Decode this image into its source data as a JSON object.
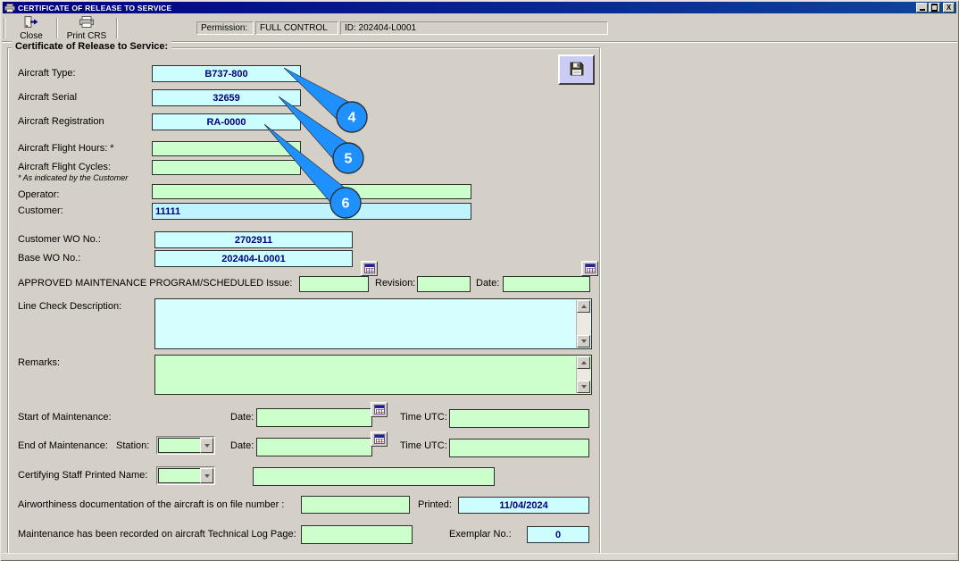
{
  "window": {
    "title": "CERTIFICATE OF RELEASE TO SERVICE",
    "close_glyph": "X"
  },
  "toolbar": {
    "close_label": "Close",
    "print_label": "Print CRS",
    "permission_label": "Permission:",
    "permission_value": "FULL CONTROL",
    "id_value": "ID: 202404-L0001"
  },
  "form": {
    "legend": "Certificate of Release to Service:",
    "aircraft_type": {
      "label": "Aircraft Type:",
      "value": "B737-800"
    },
    "aircraft_serial": {
      "label": "Aircraft Serial",
      "value": "32659"
    },
    "aircraft_registration": {
      "label": "Aircraft Registration",
      "value": "RA-0000"
    },
    "flight_hours": {
      "label": "Aircraft Flight Hours: *",
      "value": ""
    },
    "flight_cycles": {
      "label": "Aircraft Flight Cycles:",
      "value": ""
    },
    "footnote": "* As indicated by the Customer",
    "operator": {
      "label": "Operator:",
      "value": ""
    },
    "customer": {
      "label": "Customer:",
      "value": "11111"
    },
    "customer_wo": {
      "label": "Customer WO No.:",
      "value": "2702911"
    },
    "base_wo": {
      "label": "Base WO No.:",
      "value": "202404-L0001"
    },
    "amp": {
      "label": "APPROVED MAINTENANCE PROGRAM/SCHEDULED Issue:",
      "issue_value": "",
      "revision_label": "Revision:",
      "revision_value": "",
      "date_label": "Date:",
      "date_value": ""
    },
    "line_check": {
      "label": "Line Check Description:",
      "value": ""
    },
    "remarks": {
      "label": "Remarks:",
      "value": ""
    },
    "start_maintenance": {
      "label": "Start of Maintenance:",
      "date_label": "Date:",
      "date_value": "",
      "time_label": "Time UTC:",
      "time_value": ""
    },
    "end_maintenance": {
      "label": "End of Maintenance:",
      "station_label": "Station:",
      "station_value": "",
      "date_label": "Date:",
      "date_value": "",
      "time_label": "Time UTC:",
      "time_value": ""
    },
    "certifying_staff": {
      "label": "Certifying Staff Printed Name:",
      "code_value": "",
      "name_value": ""
    },
    "airworthiness": {
      "label": "Airworthiness documentation of the aircraft is on file number :",
      "file_value": "",
      "printed_label": "Printed:",
      "printed_value": "11/04/2024"
    },
    "tech_log": {
      "label": "Maintenance has been recorded on aircraft Technical Log Page:",
      "page_value": "",
      "exemplar_label": "Exemplar No.:",
      "exemplar_value": "0"
    }
  },
  "callouts": [
    {
      "number": "4"
    },
    {
      "number": "5"
    },
    {
      "number": "6"
    }
  ],
  "colors": {
    "titlebar": "#000080",
    "window_gray": "#D4D0C8",
    "field_cyan": "#CCFEFF",
    "field_green": "#CDFFCD",
    "value_navy": "#000080",
    "callout_blue": "#1E90FF"
  }
}
